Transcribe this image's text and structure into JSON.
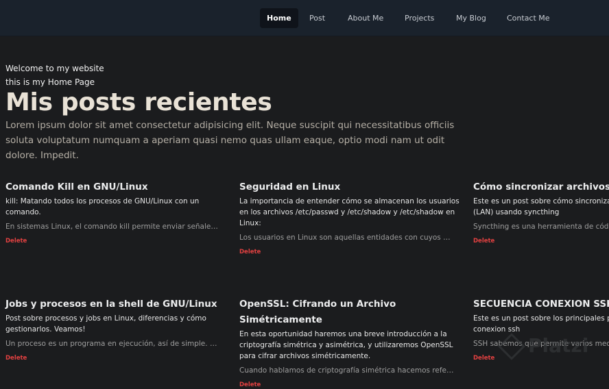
{
  "nav": {
    "items": [
      {
        "label": "Home",
        "active": true
      },
      {
        "label": "Post"
      },
      {
        "label": "About Me"
      },
      {
        "label": "Projects"
      },
      {
        "label": "My Blog"
      },
      {
        "label": "Contact Me"
      }
    ]
  },
  "hero": {
    "welcome": "Welcome to my website",
    "home": "this is my Home Page",
    "title": "Mis posts recientes",
    "description": "Lorem ipsum dolor sit amet consectetur adipisicing elit. Neque suscipit qui necessitatibus officiis soluta voluptatum numquam a aperiam quasi nemo quas ullam eaque, optio modi nam ut odit dolore. Impedit."
  },
  "posts": [
    {
      "title": "Comando Kill en GNU/Linux",
      "summary": "kill: Matando todos los procesos de GNU/Linux con un comando.",
      "excerpt": "En sistemas Linux, el comando kill permite enviar señales a los procesos",
      "delete_label": "Delete"
    },
    {
      "title": "Seguridad en Linux",
      "summary": "La importancia de entender cómo se almacenan los usuarios en los archivos /etc/passwd y /etc/shadow y /etc/shadow en Linux:",
      "excerpt": "Los usuarios en Linux son aquellas entidades con cuyos privilegios",
      "delete_label": "Delete"
    },
    {
      "title": "Cómo sincronizar archivos en Syncthing",
      "summary": "Este es un post sobre cómo sincronizar archivos en red local (LAN) usando syncthing",
      "excerpt": "Syncthing es una herramienta de código abierto",
      "delete_label": "Delete"
    },
    {
      "title": "Jobs y procesos en la shell de GNU/Linux",
      "summary": "Post sobre procesos y jobs en Linux, diferencias y cómo gestionarlos. Veamos!",
      "excerpt": "Un proceso es un programa en ejecución, así de simple. Cuando ejecutamos",
      "delete_label": "Delete"
    },
    {
      "title": "OpenSSL: Cifrando un Archivo Simétricamente",
      "summary": "En esta oportunidad haremos una breve introducción a la criptografía simétrica y asimétrica, y utilizaremos OpenSSL para cifrar archivos simétricamente.",
      "excerpt": "Cuando hablamos de criptografía simétrica hacemos referencia a",
      "delete_label": "Delete"
    },
    {
      "title": "SECUENCIA CONEXION SSH",
      "summary": "Este es un post sobre los principales pasos del proceso de conexion ssh",
      "excerpt": "SSH sabemos que permite varios mecanismos",
      "delete_label": "Delete"
    }
  ],
  "watermark": "Platzi"
}
